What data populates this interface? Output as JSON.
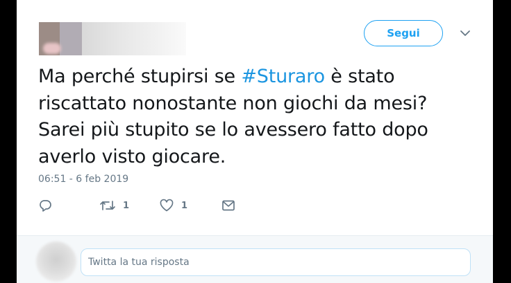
{
  "header": {
    "follow_label": "Segui",
    "menu_icon": "chevron-down-icon"
  },
  "tweet": {
    "line1_pre": "Ma perché stupirsi se ",
    "hashtag": "#Sturaro",
    "line1_post": " è stato",
    "line2": "riscattato nonostante non giochi da mesi?",
    "line3": "Sarei più stupito se lo avessero fatto dopo",
    "line4": "averlo visto giocare.",
    "timestamp": "06:51 - 6 feb 2019"
  },
  "actions": {
    "reply_icon": "reply-icon",
    "retweet_icon": "retweet-icon",
    "retweet_count": "1",
    "like_icon": "heart-icon",
    "like_count": "1",
    "dm_icon": "envelope-icon"
  },
  "reply": {
    "placeholder": "Twitta la tua risposta"
  },
  "colors": {
    "accent": "#1da1f2",
    "hashtag": "#1b95e0",
    "text": "#14171a",
    "muted": "#657786"
  }
}
